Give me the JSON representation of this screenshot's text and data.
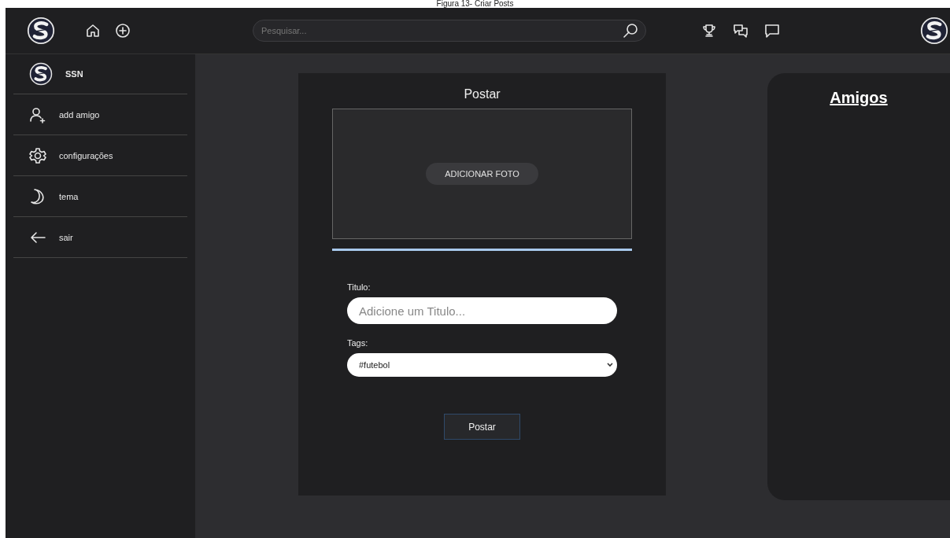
{
  "caption": "Figura 13- Criar Posts",
  "topbar": {
    "search": {
      "placeholder": "Pesquisar..."
    }
  },
  "sidebar": {
    "items": [
      {
        "kind": "logo",
        "label": "SSN"
      },
      {
        "kind": "add-friend",
        "label": "add amigo"
      },
      {
        "kind": "settings",
        "label": "configurações"
      },
      {
        "kind": "theme",
        "label": "tema"
      },
      {
        "kind": "logout",
        "label": "sair"
      }
    ]
  },
  "post_form": {
    "title": "Postar",
    "photo_button": "ADICIONAR FOTO",
    "title_label": "Titulo:",
    "title_placeholder": "Adicione um Titulo...",
    "tags_label": "Tags:",
    "tags_value": "#futebol",
    "submit": "Postar"
  },
  "friends": {
    "title": "Amigos"
  }
}
